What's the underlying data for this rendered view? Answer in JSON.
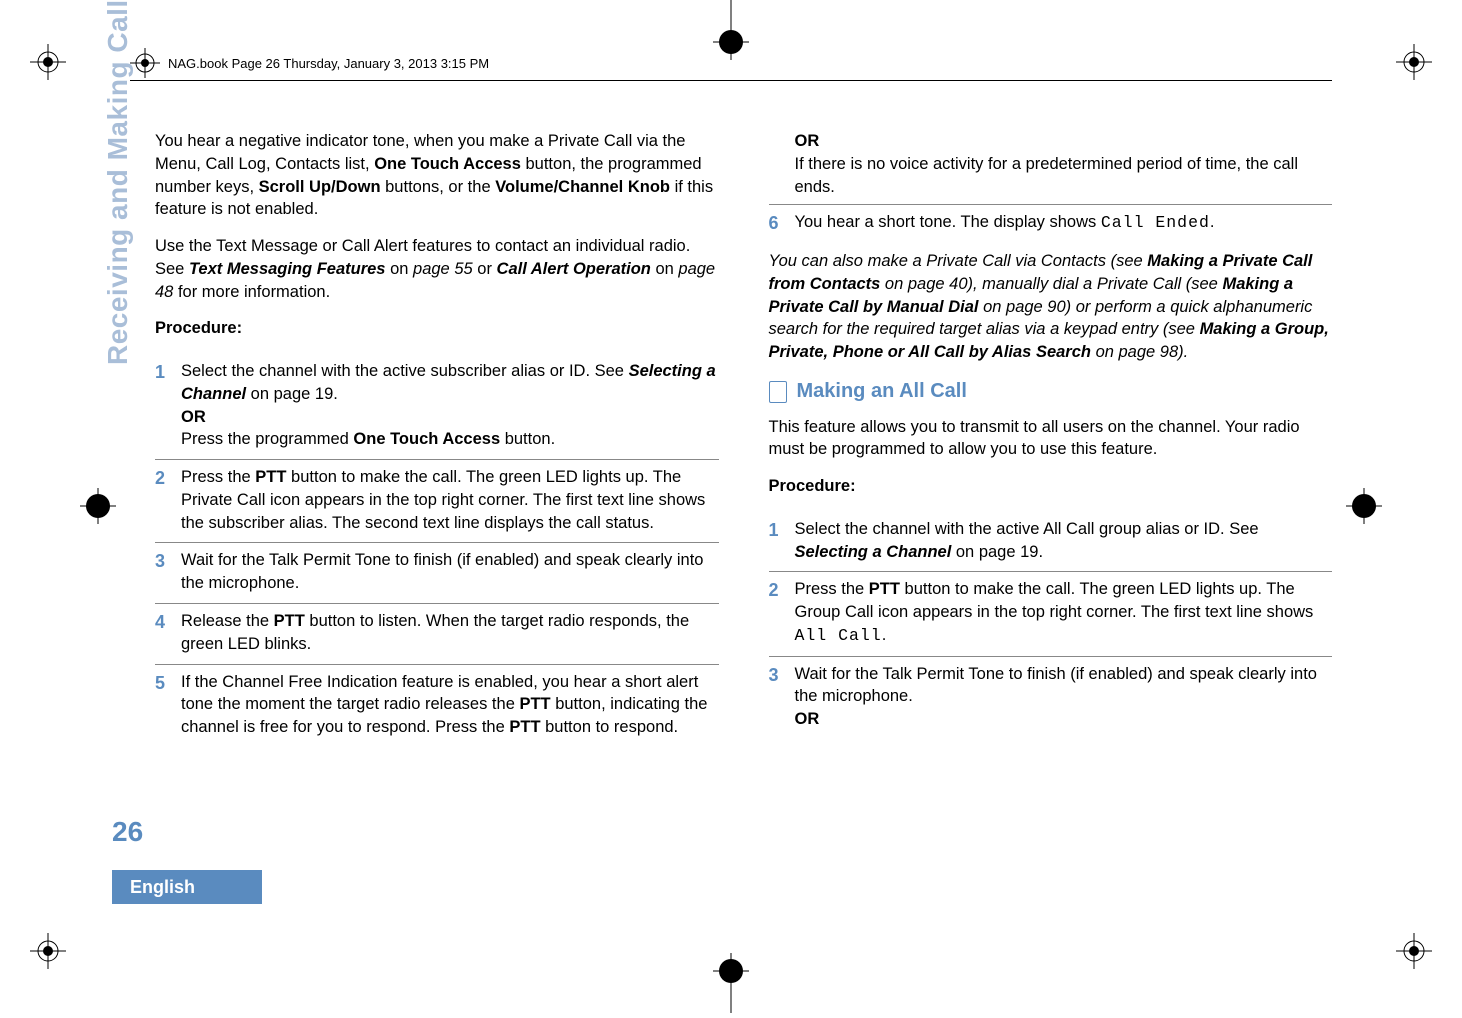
{
  "header": {
    "text": "NAG.book  Page 26  Thursday, January 3, 2013  3:15 PM"
  },
  "sidebar": {
    "tab_label": "Receiving and Making Calls",
    "page_number": "26",
    "language": "English"
  },
  "col_left": {
    "para1_pre": "You hear a negative indicator tone, when you make a Private Call via the Menu, Call Log, Contacts list, ",
    "para1_b1": "One Touch Access",
    "para1_mid1": " button, the programmed number keys, ",
    "para1_b2": "Scroll Up/Down",
    "para1_mid2": " buttons, or the ",
    "para1_b3": "Volume/Channel Knob",
    "para1_post": " if this feature is not enabled.",
    "para2_pre": "Use the Text Message or Call Alert features to contact an individual radio. See ",
    "para2_b1": "Text Messaging Features",
    "para2_mid1": " on ",
    "para2_i1": "page 55",
    "para2_mid2": " or ",
    "para2_b2": "Call Alert Operation",
    "para2_mid3": " on ",
    "para2_i2": "page 48",
    "para2_post": " for more information.",
    "procedure_label": "Procedure:",
    "steps": {
      "s1_num": "1",
      "s1_a": "Select the channel with the active subscriber alias or ID. See ",
      "s1_b1": "Selecting a Channel",
      "s1_b": " on page 19.",
      "s1_or": "OR",
      "s1_c": "Press the programmed ",
      "s1_b2": "One Touch Access",
      "s1_d": " button.",
      "s2_num": "2",
      "s2_a": "Press the ",
      "s2_b1": "PTT",
      "s2_b": " button to make the call. The green LED lights up. The Private Call icon appears in the top right corner. The first text line shows the subscriber alias. The second text line displays the call status.",
      "s3_num": "3",
      "s3_a": "Wait for the Talk Permit Tone to finish (if enabled) and speak clearly into the microphone.",
      "s4_num": "4",
      "s4_a": "Release the ",
      "s4_b1": "PTT",
      "s4_b": " button to listen. When the target radio responds, the green LED blinks.",
      "s5_num": "5",
      "s5_a": "If the Channel Free Indication feature is enabled, you hear a short alert tone the moment the target radio releases the ",
      "s5_b1": "PTT",
      "s5_b": " button, indicating the channel is free for you to respond. Press the ",
      "s5_b2": "PTT",
      "s5_c": " button to respond."
    }
  },
  "col_right": {
    "or_label": "OR",
    "or_text": "If there is no voice activity for a predetermined period of time, the call ends.",
    "s6_num": "6",
    "s6_a": "You hear a short tone. The display shows ",
    "s6_mono": "Call Ended",
    "s6_b": ".",
    "italic": {
      "a": "You can also make a Private Call via Contacts (see ",
      "b1": "Making a Private Call from Contacts",
      "b": " on page 40), manually dial a Private Call (see ",
      "b2": "Making a Private Call by Manual Dial",
      "c": " on page 90) or perform a quick alphanumeric search for the required target alias via a keypad entry (see ",
      "b3": "Making a Group, Private, Phone or All Call by Alias Search",
      "d": " on page 98)."
    },
    "section_title": "Making an All Call",
    "intro": "This feature allows you to transmit to all users on the channel. Your radio must be programmed to allow you to use this feature.",
    "procedure_label": "Procedure:",
    "steps": {
      "s1_num": "1",
      "s1_a": "Select the channel with the active All Call group alias or ID. See ",
      "s1_b1": "Selecting a Channel",
      "s1_b": " on page 19.",
      "s2_num": "2",
      "s2_a": "Press the ",
      "s2_b1": "PTT",
      "s2_b": " button to make the call. The green LED lights up. The Group Call icon appears in the top right corner. The first text line shows ",
      "s2_mono": "All Call",
      "s2_c": ".",
      "s3_num": "3",
      "s3_a": "Wait for the Talk Permit Tone to finish (if enabled) and speak clearly into the microphone.",
      "s3_or": "OR"
    }
  }
}
